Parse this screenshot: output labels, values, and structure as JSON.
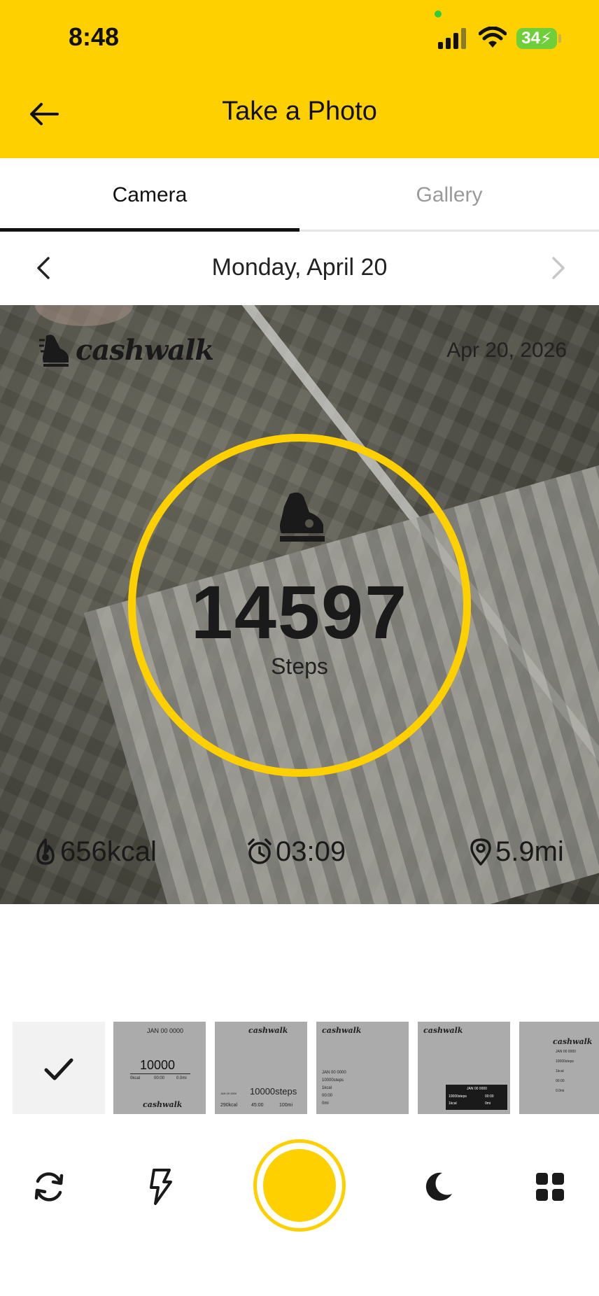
{
  "status_bar": {
    "time": "8:48",
    "battery": "34"
  },
  "header": {
    "title": "Take a Photo",
    "back_icon": "arrow-left-icon"
  },
  "tabs": [
    {
      "label": "Camera",
      "active": true
    },
    {
      "label": "Gallery",
      "active": false
    }
  ],
  "date_nav": {
    "label": "Monday, April 20"
  },
  "preview": {
    "logo_text": "cashwalk",
    "date": "Apr 20, 2026",
    "steps": "14597",
    "steps_label": "Steps",
    "stats": {
      "calories": "656kcal",
      "time": "03:09",
      "distance": "5.9mi"
    }
  },
  "templates": [
    {
      "selected": true
    },
    {
      "date": "JAN 00 0000",
      "steps": "10000",
      "row": [
        "0kcal",
        "00:00",
        "0.0mi"
      ],
      "logo": "cashwalk"
    },
    {
      "logo": "cashwalk",
      "steps": "10000steps",
      "row": [
        "290kcal",
        "45:00",
        "100mi"
      ],
      "date": "JAN 00 0000"
    },
    {
      "logo": "cashwalk",
      "lines": [
        "JAN 00 0000",
        "10000steps",
        "1kcal",
        "00:00",
        "0mi"
      ]
    },
    {
      "logo": "cashwalk",
      "date": "JAN 00 0000",
      "row": [
        "10000steps",
        "00:00",
        "1kcal",
        "0mi"
      ]
    },
    {
      "logo": "cashwalk",
      "lines": [
        "JAN 00 0000",
        "10000steps",
        "1kcal",
        "00:00",
        "0.0mi"
      ]
    }
  ],
  "controls": {
    "switch_icon": "camera-switch-icon",
    "flash_icon": "flash-icon",
    "night_icon": "moon-icon",
    "grid_icon": "grid-icon"
  },
  "colors": {
    "accent": "#FFD000",
    "text": "#111111",
    "inactive": "#9a9a9a"
  }
}
